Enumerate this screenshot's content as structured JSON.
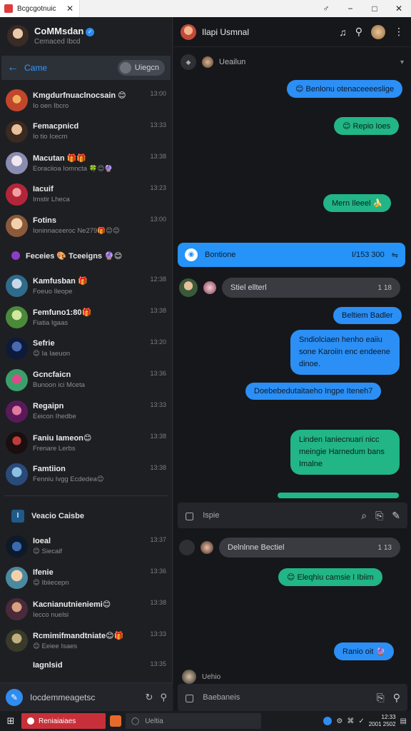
{
  "window": {
    "tab_title": "Bcgcgotnuic",
    "controls": [
      "♂",
      "−",
      "□",
      "✕"
    ]
  },
  "profile": {
    "name": "CoMMsdan",
    "subtitle": "Cemaced Ibcd"
  },
  "search": {
    "back_label": "Came",
    "pill_label": "Uiegcn"
  },
  "chats": [
    {
      "name": "Kmgdurfnuaclnocsain 😊",
      "preview": "Io oen Ibcro",
      "time": "13:00",
      "color": "#c0472b"
    },
    {
      "name": "Femacpnicd",
      "preview": "Io tio Icecm",
      "time": "13:33",
      "color": "#7a5a3b"
    },
    {
      "name": "Macutan 🎁🎁",
      "preview": "Eoraciioa Iomncta 🍀😊🔮",
      "time": "13:38",
      "color": "#b6b9c8"
    },
    {
      "name": "Iacuif",
      "preview": "Imstir Lheca",
      "time": "13:23",
      "color": "#b3263a"
    },
    {
      "name": "Fotins",
      "preview": "Ioninnaceeroc Ne279🎁😊😊",
      "time": "13:00",
      "color": "#d9b38a"
    },
    {
      "name": "Kamfusban 🎁",
      "preview": "Foeuo Ileope",
      "time": "12:38",
      "color": "#2f6b8a"
    },
    {
      "name": "Femfuno1:80🎁",
      "preview": "Fiatia Igaas",
      "time": "13:38",
      "color": "#4a8a3a"
    },
    {
      "name": "Sefrie",
      "preview": "😊 Ia Iaeuon",
      "time": "13:20",
      "color": "#1b3a7a"
    },
    {
      "name": "Gcncfaicn",
      "preview": "Bunoon ici Mceta",
      "time": "13:36",
      "color": "#3aa06a"
    },
    {
      "name": "Regaipn",
      "preview": "Eeicon Ihedbe",
      "time": "13:33",
      "color": "#b33a6a"
    },
    {
      "name": "Faniu Iameon😊",
      "preview": "Frenare Lerbs",
      "time": "13:38",
      "color": "#2a1a1a"
    },
    {
      "name": "Famtiion",
      "preview": "Fenniu Ivgg Ecdedea😊",
      "time": "13:38",
      "color": "#3a6aa0"
    }
  ],
  "group_row": {
    "label": "Feceies 🎨 Tceeigns 🔮😊"
  },
  "section": {
    "badge": "I",
    "label": "Veacio Caisbe"
  },
  "chats2": [
    {
      "name": "Ioeal",
      "preview": "😊 Siecaif",
      "time": "13:37",
      "color": "#1b2a4a"
    },
    {
      "name": "Ifenie",
      "preview": "😊 Ibiiecepn",
      "time": "13:36",
      "color": "#d9b48a"
    },
    {
      "name": "Kacnianutnieniemi😊",
      "preview": "Iecco nuelsi",
      "time": "13:38",
      "color": "#4a2a3a"
    },
    {
      "name": "Rcmimifmandtniate😊🎁",
      "preview": "😊 Eeiee Isaes",
      "time": "13:33",
      "color": "#6a5a3a"
    },
    {
      "name": "Iagnlsid",
      "preview": "",
      "time": "13:35",
      "color": "#333"
    }
  ],
  "side_compose": {
    "placeholder": "Iocdemmeagetsc",
    "icons": [
      "↻",
      "⚲"
    ]
  },
  "header": {
    "title": "Ilapi Usmnal",
    "icons": [
      "♫",
      "⚲",
      "⌕"
    ]
  },
  "subhead": {
    "label": "Ueailun"
  },
  "bubbles": [
    {
      "text": "Benlonu otenaceeeeslige",
      "kind": "blue"
    },
    {
      "text": "Repio Ioes",
      "kind": "green"
    },
    {
      "text": "Mern Ileeel",
      "kind": "green"
    },
    {
      "text": "Beltiem Badler",
      "kind": "blue"
    },
    {
      "text": "Sndiolciaen henho eaiiu sone Karoiin enc endeene dinoe.",
      "kind": "blue"
    },
    {
      "text": "Doebebedutaitaeho Ingpe Iteneh7",
      "kind": "blue"
    },
    {
      "text": "Linden Ianiecnuari nicc meingie Harnedum bans Imalne",
      "kind": "green"
    },
    {
      "text": "Eleqhiu camsie I Ibiim",
      "kind": "green"
    },
    {
      "text": "Ranio oit",
      "kind": "blue"
    }
  ],
  "banner": {
    "label": "Bontione",
    "amount": "I/153 300"
  },
  "msgrow1": {
    "text": "Stiel ellterl",
    "count": "1 18"
  },
  "msgrow2": {
    "text": "Delnlnne Bectiel",
    "count": "1 13"
  },
  "inputbar1": {
    "placeholder": "Ispie"
  },
  "inputbar2": {
    "placeholder": "Baebaneis"
  },
  "footer_name": "Uehio",
  "taskbar": {
    "app_label": "Reniaiaiaes",
    "search_placeholder": "Ueltia",
    "clock_time": "12:33",
    "clock_date": "2001 2502"
  }
}
